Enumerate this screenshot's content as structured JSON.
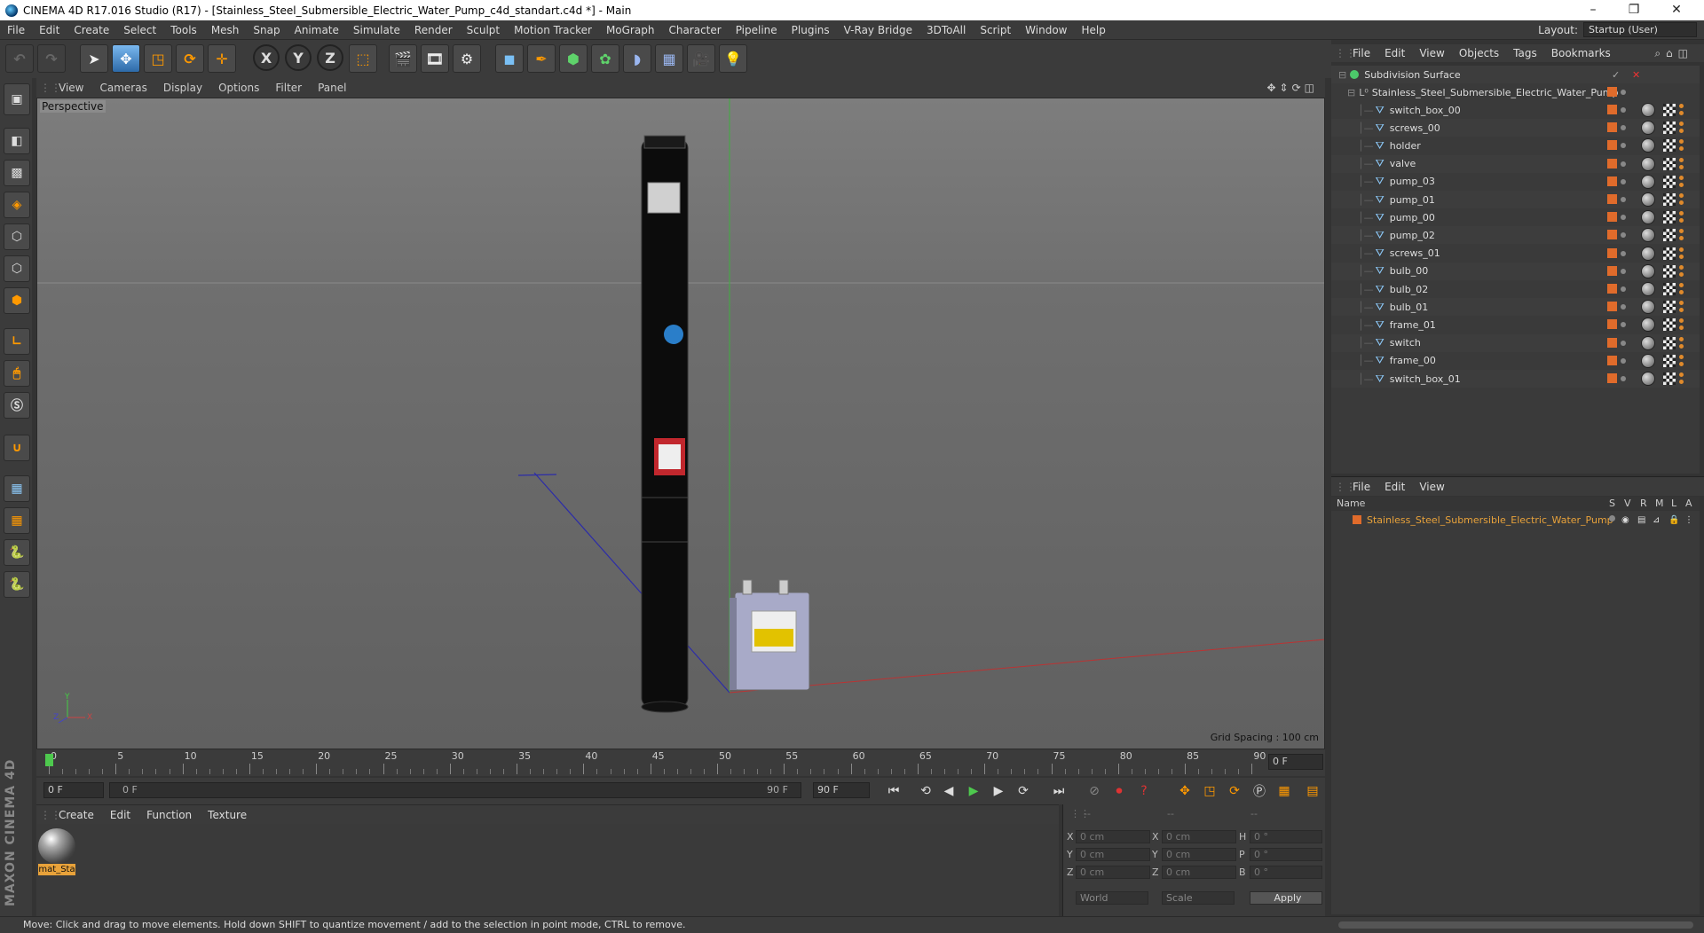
{
  "window": {
    "title": "CINEMA 4D R17.016 Studio (R17) - [Stainless_Steel_Submersible_Electric_Water_Pump_c4d_standart.c4d *] - Main",
    "minimize": "–",
    "maximize": "❐",
    "close": "✕"
  },
  "menubar": {
    "items": [
      "File",
      "Edit",
      "Create",
      "Select",
      "Tools",
      "Mesh",
      "Snap",
      "Animate",
      "Simulate",
      "Render",
      "Sculpt",
      "Motion Tracker",
      "MoGraph",
      "Character",
      "Pipeline",
      "Plugins",
      "V-Ray Bridge",
      "3DToAll",
      "Script",
      "Window",
      "Help"
    ],
    "layout_label": "Layout:",
    "layout_value": "Startup (User)"
  },
  "toolbar": {
    "axis_x": "X",
    "axis_y": "Y",
    "axis_z": "Z",
    "icons": [
      "undo-icon",
      "redo-icon",
      "select-arrow-icon",
      "move-icon",
      "scale-icon",
      "rotate-icon",
      "add-icon",
      "x-axis-icon",
      "y-axis-icon",
      "z-axis-icon",
      "coordinate-system-icon",
      "render-view-icon",
      "render-picture-viewer-icon",
      "edit-render-settings-icon",
      "cube-icon",
      "pen-spline-icon",
      "subdivision-icon",
      "array-icon",
      "deformer-icon",
      "floor-icon",
      "camera-icon",
      "light-icon"
    ]
  },
  "viewport": {
    "menu": [
      "View",
      "Cameras",
      "Display",
      "Options",
      "Filter",
      "Panel"
    ],
    "label": "Perspective",
    "grid_spacing": "Grid Spacing : 100 cm",
    "axis_x": "X",
    "axis_y": "Y",
    "axis_z": "Z"
  },
  "timeline": {
    "ticks": [
      "0",
      "5",
      "10",
      "15",
      "20",
      "25",
      "30",
      "35",
      "40",
      "45",
      "50",
      "55",
      "60",
      "65",
      "70",
      "75",
      "80",
      "85",
      "90"
    ],
    "current_frame_field": "0 F",
    "start_field": "0 F",
    "range_start": "0 F",
    "range_end": "90 F",
    "end_field": "90 F"
  },
  "materials": {
    "menu": [
      "Create",
      "Edit",
      "Function",
      "Texture"
    ],
    "items": [
      {
        "name": "mat_Sta"
      }
    ]
  },
  "coordinates": {
    "headers": [
      "--",
      "--",
      "--"
    ],
    "rows": [
      {
        "label1": "X",
        "val1": "0 cm",
        "label2": "X",
        "val2": "0 cm",
        "label3": "H",
        "val3": "0 °"
      },
      {
        "label1": "Y",
        "val1": "0 cm",
        "label2": "Y",
        "val2": "0 cm",
        "label3": "P",
        "val3": "0 °"
      },
      {
        "label1": "Z",
        "val1": "0 cm",
        "label2": "Z",
        "val2": "0 cm",
        "label3": "B",
        "val3": "0 °"
      }
    ],
    "space_select": "World",
    "mode_select": "Scale",
    "apply_label": "Apply"
  },
  "object_manager": {
    "menu": [
      "File",
      "Edit",
      "View",
      "Objects",
      "Tags",
      "Bookmarks"
    ],
    "root": "Subdivision Surface",
    "group": "Stainless_Steel_Submersible_Electric_Water_Pump",
    "children": [
      "switch_box_00",
      "screws_00",
      "holder",
      "valve",
      "pump_03",
      "pump_01",
      "pump_00",
      "pump_02",
      "screws_01",
      "bulb_00",
      "bulb_02",
      "bulb_01",
      "frame_01",
      "switch",
      "frame_00",
      "switch_box_01"
    ]
  },
  "layer_manager": {
    "menu": [
      "File",
      "Edit",
      "View"
    ],
    "columns": [
      "Name",
      "S",
      "V",
      "R",
      "M",
      "L",
      "A"
    ],
    "rows": [
      "Stainless_Steel_Submersible_Electric_Water_Pump"
    ]
  },
  "status": {
    "text": "Move: Click and drag to move elements. Hold down SHIFT to quantize movement / add to the selection in point mode, CTRL to remove."
  },
  "branding": "MAXON CINEMA 4D",
  "colors": {
    "accent_orange": "#e8a23a",
    "selection_orange": "#e06b2b",
    "timeline_green": "#4ec94e"
  }
}
